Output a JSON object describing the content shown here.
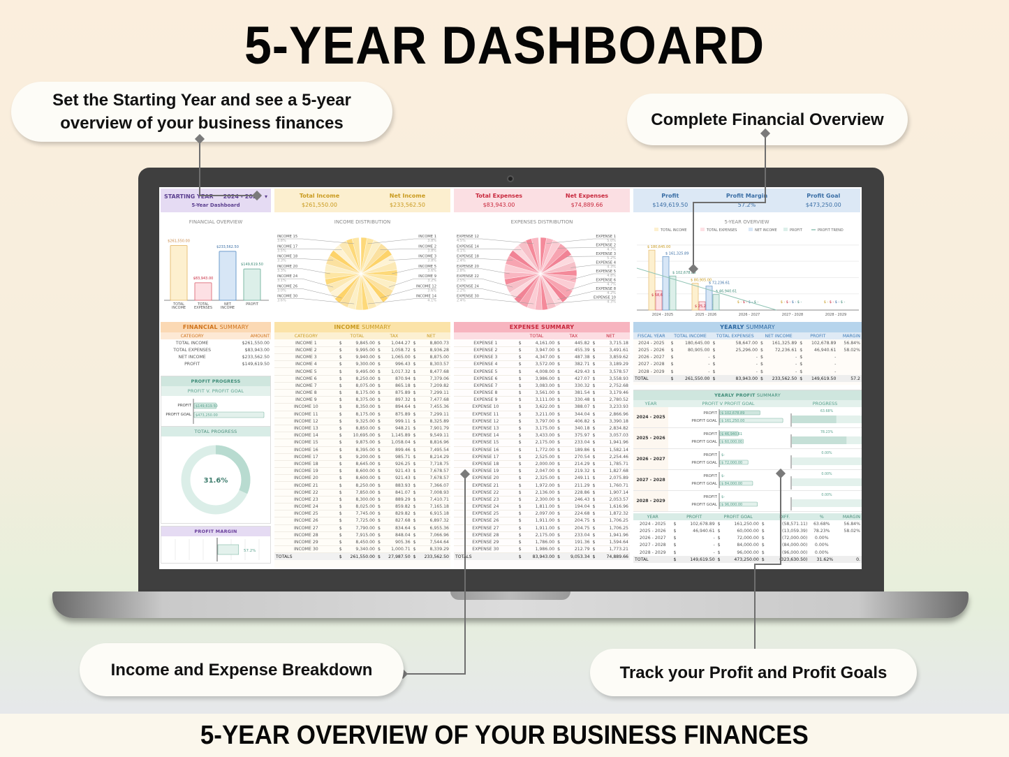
{
  "page": {
    "title": "5-YEAR DASHBOARD",
    "footer": "5-YEAR OVERVIEW OF YOUR BUSINESS FINANCES"
  },
  "callouts": {
    "starting_year": "Set the Starting Year and see a 5-year overview of your business finances",
    "financial_overview": "Complete Financial Overview",
    "breakdown": "Income and Expense Breakdown",
    "profit_goals": "Track your Profit and Profit Goals"
  },
  "header": {
    "starting_year_label": "STARTING YEAR",
    "starting_year_value": "2024 - 2025",
    "dropdown_icon": "chevron-down-icon",
    "subtitle": "5-Year Dashboard",
    "total_income_label": "Total Income",
    "total_income": "$261,550.00",
    "net_income_label": "Net Income",
    "net_income": "$233,562.50",
    "total_expenses_label": "Total Expenses",
    "total_expenses": "$83,943.00",
    "net_expenses_label": "Net Expenses",
    "net_expenses": "$74,889.66",
    "profit_label": "Profit",
    "profit": "$149,619.50",
    "profit_margin_label": "Profit Margin",
    "profit_margin": "57.2%",
    "profit_goal_label": "Profit Goal",
    "profit_goal": "$473,250.00"
  },
  "colors": {
    "income": "#f3c96b",
    "expense": "#e8707e",
    "net": "#7fa8d6",
    "profit": "#8fc3b4",
    "purple": "#e5dbf3",
    "yellow": "#fcefcf",
    "pink": "#fbdfe3",
    "blue": "#dce8f5",
    "teal": "#d5ebe4"
  },
  "chart_data": [
    {
      "id": "financial_overview",
      "type": "bar",
      "title": "FINANCIAL OVERVIEW",
      "categories": [
        "TOTAL INCOME",
        "TOTAL EXPENSES",
        "NET INCOME",
        "PROFIT"
      ],
      "values": [
        261550.0,
        83943.0,
        233562.5,
        149619.5
      ],
      "labels": [
        "$261,550.00",
        "$83,943.00",
        "$233,562.50",
        "$149,619.50"
      ],
      "ylim": [
        0,
        300000
      ]
    },
    {
      "id": "income_distribution",
      "type": "pie",
      "title": "INCOME DISTRIBUTION",
      "labeled_slices": [
        {
          "label": "INCOME 1",
          "pct": "3.8%"
        },
        {
          "label": "INCOME 2",
          "pct": "3.8%"
        },
        {
          "label": "INCOME 3",
          "pct": "3.8%"
        },
        {
          "label": "INCOME 5",
          "pct": "3.6%"
        },
        {
          "label": "INCOME 9",
          "pct": "3.2%"
        },
        {
          "label": "INCOME 12",
          "pct": "3.6%"
        },
        {
          "label": "INCOME 14",
          "pct": "4.1%"
        },
        {
          "label": "INCOME 15",
          "pct": "3.8%"
        },
        {
          "label": "INCOME 17",
          "pct": "3.5%"
        },
        {
          "label": "INCOME 18",
          "pct": "3.3%"
        },
        {
          "label": "INCOME 20",
          "pct": "3.3%"
        },
        {
          "label": "INCOME 24",
          "pct": "3.1%"
        },
        {
          "label": "INCOME 26",
          "pct": "3.0%"
        },
        {
          "label": "INCOME 30",
          "pct": "3.6%"
        }
      ]
    },
    {
      "id": "expenses_distribution",
      "type": "pie",
      "title": "EXPENSES DISTRIBUTION",
      "labeled_slices": [
        {
          "label": "EXPENSE 1",
          "pct": "5.0%"
        },
        {
          "label": "EXPENSE 2",
          "pct": "4.7%"
        },
        {
          "label": "EXPENSE 3",
          "pct": "5.2%"
        },
        {
          "label": "EXPENSE 4",
          "pct": "4.3%"
        },
        {
          "label": "EXPENSE 5",
          "pct": "4.8%"
        },
        {
          "label": "EXPENSE 6",
          "pct": "4.7%"
        },
        {
          "label": "EXPENSE 8",
          "pct": "4.2%"
        },
        {
          "label": "EXPENSE 10",
          "pct": "4.3%"
        },
        {
          "label": "EXPENSE 12",
          "pct": "4.5%"
        },
        {
          "label": "EXPENSE 14",
          "pct": "4.1%"
        },
        {
          "label": "EXPENSE 18",
          "pct": "2.4%"
        },
        {
          "label": "EXPENSE 20",
          "pct": "2.8%"
        },
        {
          "label": "EXPENSE 22",
          "pct": "2.5%"
        },
        {
          "label": "EXPENSE 24",
          "pct": "2.2%"
        },
        {
          "label": "EXPENSE 30",
          "pct": "2.4%"
        }
      ]
    },
    {
      "id": "five_year_overview",
      "type": "bar",
      "title": "5-YEAR OVERVIEW",
      "legend": [
        "TOTAL INCOME",
        "TOTAL EXPENSES",
        "NET INCOME",
        "PROFIT",
        "PROFIT TREND"
      ],
      "legend_position": "top",
      "categories": [
        "2024 - 2025",
        "2025 - 2026",
        "2026 - 2027",
        "2027 - 2028",
        "2028 - 2029"
      ],
      "series": [
        {
          "name": "TOTAL INCOME",
          "values": [
            180645.0,
            80905.0,
            0,
            0,
            0
          ],
          "labels": [
            "$ 180,645.00",
            "$ 80,905.00",
            "$ -",
            "$ -",
            "$ -"
          ]
        },
        {
          "name": "TOTAL EXPENSES",
          "values": [
            58647.0,
            25296.0,
            0,
            0,
            0
          ],
          "labels": [
            "$ 58,647.00",
            "$ 25,296.00",
            "$ -",
            "$ -",
            "$ -"
          ]
        },
        {
          "name": "NET INCOME",
          "values": [
            161325.89,
            72236.61,
            0,
            0,
            0
          ],
          "labels": [
            "$ 161,325.89",
            "$ 72,236.61",
            "$ -",
            "$ -",
            "$ -"
          ]
        },
        {
          "name": "PROFIT",
          "values": [
            102678.89,
            46940.61,
            0,
            0,
            0
          ],
          "labels": [
            "$ 102,678.89",
            "$ 46,940.61",
            "$ -",
            "$ -",
            "$ -"
          ]
        }
      ],
      "ylim": [
        0,
        200000
      ]
    },
    {
      "id": "total_progress",
      "type": "pie",
      "title": "TOTAL PROGRESS",
      "values": [
        31.6,
        68.4
      ],
      "label": "31.6%"
    },
    {
      "id": "profit_margin",
      "type": "bar",
      "title": "PROFIT MARGIN",
      "values": [
        57.2
      ],
      "label": "57.2%"
    }
  ],
  "financial_summary": {
    "title_bold": "FINANCIAL",
    "title_rest": " SUMMARY",
    "headers": [
      "CATEGORY",
      "AMOUNT"
    ],
    "rows": [
      [
        "TOTAL INCOME",
        "$261,550.00"
      ],
      [
        "TOTAL EXPENSES",
        "$83,943.00"
      ],
      [
        "NET INCOME",
        "$233,562.50"
      ],
      [
        "PROFIT",
        "$149,619.50"
      ]
    ]
  },
  "profit_progress": {
    "title": "PROFIT PROGRESS",
    "subtitle": "PROFIT V. PROFIT GOAL",
    "profit_label": "PROFIT",
    "profit_value": "$149,619.50",
    "goal_label": "PROFIT GOAL",
    "goal_value": "$473,250.00",
    "profit_fraction": 0.316,
    "total_progress_title": "TOTAL PROGRESS",
    "total_progress_value": "31.6%",
    "margin_title": "PROFIT MARGIN",
    "margin_value": "57.2%"
  },
  "income_summary": {
    "title_bold": "INCOME",
    "title_rest": " SUMMARY",
    "headers": [
      "CATEGORY",
      "TOTAL",
      "TAX",
      "NET"
    ],
    "rows": [
      [
        "INCOME 1",
        "9,845.00",
        "1,044.27",
        "8,800.73"
      ],
      [
        "INCOME 2",
        "9,995.00",
        "1,058.72",
        "8,936.28"
      ],
      [
        "INCOME 3",
        "9,940.00",
        "1,065.00",
        "8,875.00"
      ],
      [
        "INCOME 4",
        "9,300.00",
        "996.43",
        "8,303.57"
      ],
      [
        "INCOME 5",
        "9,495.00",
        "1,017.32",
        "8,477.68"
      ],
      [
        "INCOME 6",
        "8,250.00",
        "870.94",
        "7,379.06"
      ],
      [
        "INCOME 7",
        "8,075.00",
        "865.18",
        "7,209.82"
      ],
      [
        "INCOME 8",
        "8,175.00",
        "875.89",
        "7,299.11"
      ],
      [
        "INCOME 9",
        "8,375.00",
        "897.32",
        "7,477.68"
      ],
      [
        "INCOME 10",
        "8,350.00",
        "894.64",
        "7,455.36"
      ],
      [
        "INCOME 11",
        "8,175.00",
        "875.89",
        "7,299.11"
      ],
      [
        "INCOME 12",
        "9,325.00",
        "999.11",
        "8,325.89"
      ],
      [
        "INCOME 13",
        "8,850.00",
        "948.21",
        "7,901.79"
      ],
      [
        "INCOME 14",
        "10,695.00",
        "1,145.89",
        "9,549.11"
      ],
      [
        "INCOME 15",
        "9,875.00",
        "1,058.04",
        "8,816.96"
      ],
      [
        "INCOME 16",
        "8,395.00",
        "899.46",
        "7,495.54"
      ],
      [
        "INCOME 17",
        "9,200.00",
        "985.71",
        "8,214.29"
      ],
      [
        "INCOME 18",
        "8,645.00",
        "926.25",
        "7,718.75"
      ],
      [
        "INCOME 19",
        "8,600.00",
        "921.43",
        "7,678.57"
      ],
      [
        "INCOME 20",
        "8,600.00",
        "921.43",
        "7,678.57"
      ],
      [
        "INCOME 21",
        "8,250.00",
        "883.93",
        "7,366.07"
      ],
      [
        "INCOME 22",
        "7,850.00",
        "841.07",
        "7,008.93"
      ],
      [
        "INCOME 23",
        "8,300.00",
        "889.29",
        "7,410.71"
      ],
      [
        "INCOME 24",
        "8,025.00",
        "859.82",
        "7,165.18"
      ],
      [
        "INCOME 25",
        "7,745.00",
        "829.82",
        "6,915.18"
      ],
      [
        "INCOME 26",
        "7,725.00",
        "827.68",
        "6,897.32"
      ],
      [
        "INCOME 27",
        "7,790.00",
        "834.64",
        "6,955.36"
      ],
      [
        "INCOME 28",
        "7,915.00",
        "848.04",
        "7,066.96"
      ],
      [
        "INCOME 29",
        "8,450.00",
        "905.36",
        "7,544.64"
      ],
      [
        "INCOME 30",
        "9,340.00",
        "1,000.71",
        "8,339.29"
      ]
    ],
    "totals": [
      "TOTALS",
      "261,550.00",
      "27,987.50",
      "233,562.50"
    ]
  },
  "expense_summary": {
    "title": "EXPENSE SUMMARY",
    "headers": [
      "",
      "TOTAL",
      "TAX",
      "NET"
    ],
    "rows": [
      [
        "EXPENSE 1",
        "4,161.00",
        "445.82",
        "3,715.18"
      ],
      [
        "EXPENSE 2",
        "3,947.00",
        "455.39",
        "3,491.61"
      ],
      [
        "EXPENSE 3",
        "4,347.00",
        "487.38",
        "3,859.62"
      ],
      [
        "EXPENSE 4",
        "3,572.00",
        "382.71",
        "3,189.29"
      ],
      [
        "EXPENSE 5",
        "4,008.00",
        "429.43",
        "3,578.57"
      ],
      [
        "EXPENSE 6",
        "3,986.00",
        "427.07",
        "3,558.93"
      ],
      [
        "EXPENSE 7",
        "3,083.00",
        "330.32",
        "2,752.68"
      ],
      [
        "EXPENSE 8",
        "3,561.00",
        "381.54",
        "3,179.46"
      ],
      [
        "EXPENSE 9",
        "3,111.00",
        "330.48",
        "2,780.52"
      ],
      [
        "EXPENSE 10",
        "3,622.00",
        "388.07",
        "3,233.93"
      ],
      [
        "EXPENSE 11",
        "3,211.00",
        "344.04",
        "2,866.96"
      ],
      [
        "EXPENSE 12",
        "3,797.00",
        "406.82",
        "3,390.18"
      ],
      [
        "EXPENSE 13",
        "3,175.00",
        "340.18",
        "2,834.82"
      ],
      [
        "EXPENSE 14",
        "3,433.00",
        "375.97",
        "3,057.03"
      ],
      [
        "EXPENSE 15",
        "2,175.00",
        "233.04",
        "1,941.96"
      ],
      [
        "EXPENSE 16",
        "1,772.00",
        "189.86",
        "1,582.14"
      ],
      [
        "EXPENSE 17",
        "2,525.00",
        "270.54",
        "2,254.46"
      ],
      [
        "EXPENSE 18",
        "2,000.00",
        "214.29",
        "1,785.71"
      ],
      [
        "EXPENSE 19",
        "2,047.00",
        "219.32",
        "1,827.68"
      ],
      [
        "EXPENSE 20",
        "2,325.00",
        "249.11",
        "2,075.89"
      ],
      [
        "EXPENSE 21",
        "1,972.00",
        "211.29",
        "1,760.71"
      ],
      [
        "EXPENSE 22",
        "2,136.00",
        "228.86",
        "1,907.14"
      ],
      [
        "EXPENSE 23",
        "2,300.00",
        "246.43",
        "2,053.57"
      ],
      [
        "EXPENSE 24",
        "1,811.00",
        "194.04",
        "1,616.96"
      ],
      [
        "EXPENSE 25",
        "2,097.00",
        "224.68",
        "1,872.32"
      ],
      [
        "EXPENSE 26",
        "1,911.00",
        "204.75",
        "1,706.25"
      ],
      [
        "EXPENSE 27",
        "1,911.00",
        "204.75",
        "1,706.25"
      ],
      [
        "EXPENSE 28",
        "2,175.00",
        "233.04",
        "1,941.96"
      ],
      [
        "EXPENSE 29",
        "1,786.00",
        "191.36",
        "1,594.64"
      ],
      [
        "EXPENSE 30",
        "1,986.00",
        "212.79",
        "1,773.21"
      ]
    ],
    "totals": [
      "TOTALS",
      "83,943.00",
      "9,053.34",
      "74,889.66"
    ]
  },
  "yearly_summary": {
    "title_bold": "YEARLY",
    "title_rest": " SUMMARY",
    "headers": [
      "FISCAL YEAR",
      "TOTAL INCOME",
      "TOTAL EXPENSES",
      "NET INCOME",
      "PROFIT",
      "MARGIN"
    ],
    "rows": [
      [
        "2024 - 2025",
        "180,645.00",
        "58,647.00",
        "161,325.89",
        "102,678.89",
        "56.84%"
      ],
      [
        "2025 - 2026",
        "80,905.00",
        "25,296.00",
        "72,236.61",
        "46,940.61",
        "58.02%"
      ],
      [
        "2026 - 2027",
        "-",
        "-",
        "-",
        "-",
        ""
      ],
      [
        "2027 - 2028",
        "-",
        "-",
        "-",
        "-",
        ""
      ],
      [
        "2028 - 2029",
        "-",
        "-",
        "-",
        "-",
        ""
      ]
    ],
    "totals": [
      "TOTAL",
      "261,550.00",
      "83,943.00",
      "233,562.50",
      "149,619.50",
      "57.2"
    ]
  },
  "yearly_profit": {
    "title_bold": "YEARLY PROFIT",
    "title_rest": " SUMMARY",
    "headers": [
      "YEAR",
      "PROFIT V PROFIT GOAL",
      "PROGRESS"
    ],
    "profit_label": "PROFIT",
    "goal_label": "PROFIT GOAL",
    "rows": [
      {
        "year": "2024 - 2025",
        "profit": "$ 102,678.89",
        "goal": "$ 161,250.00",
        "profit_val": 102678.89,
        "goal_val": 161250,
        "progress": "63.68%",
        "progress_frac": 0.6368
      },
      {
        "year": "2025 - 2026",
        "profit": "$ 46,940.61",
        "goal": "$ 60,000.00",
        "profit_val": 46940.61,
        "goal_val": 60000,
        "progress": "78.23%",
        "progress_frac": 0.7823
      },
      {
        "year": "2026 - 2027",
        "profit": "$-",
        "goal": "$ 72,000.00",
        "profit_val": 0,
        "goal_val": 72000,
        "progress": "0.00%",
        "progress_frac": 0
      },
      {
        "year": "2027 - 2028",
        "profit": "$-",
        "goal": "$ 84,000.00",
        "profit_val": 0,
        "goal_val": 84000,
        "progress": "0.00%",
        "progress_frac": 0
      },
      {
        "year": "2028 - 2029",
        "profit": "$-",
        "goal": "$ 96,000.00",
        "profit_val": 0,
        "goal_val": 96000,
        "progress": "0.00%",
        "progress_frac": 0
      }
    ]
  },
  "profit_goal_table": {
    "headers": [
      "YEAR",
      "PROFIT",
      "PROFIT GOAL",
      "DIFF.",
      "%",
      "MARGIN"
    ],
    "rows": [
      [
        "2024 - 2025",
        "102,678.89",
        "161,250.00",
        "(58,571.11)",
        "63.68%",
        "56.84%"
      ],
      [
        "2025 - 2026",
        "46,940.61",
        "60,000.00",
        "(13,059.39)",
        "78.23%",
        "58.02%"
      ],
      [
        "2026 - 2027",
        "-",
        "72,000.00",
        "(72,000.00)",
        "0.00%",
        ""
      ],
      [
        "2027 - 2028",
        "-",
        "84,000.00",
        "(84,000.00)",
        "0.00%",
        ""
      ],
      [
        "2028 - 2029",
        "-",
        "96,000.00",
        "(96,000.00)",
        "0.00%",
        ""
      ]
    ],
    "totals": [
      "TOTAL",
      "149,619.50",
      "473,250.00",
      "(323,630.50)",
      "31.62%",
      "0."
    ]
  },
  "currency": "$"
}
